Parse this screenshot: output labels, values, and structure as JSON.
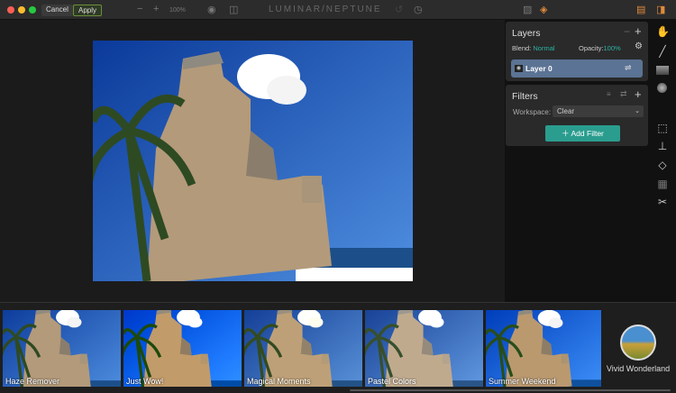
{
  "window": {
    "title": "LUMINAR/NEPTUNE",
    "cancel": "Cancel",
    "apply": "Apply",
    "zoom": "100%",
    "zoom_out": "−",
    "zoom_in": "+"
  },
  "layers": {
    "title": "Layers",
    "blend_label": "Blend:",
    "blend_value": "Normal",
    "opacity_label": "Opacity:",
    "opacity_value": "100%",
    "layer_name": "Layer 0"
  },
  "filters": {
    "title": "Filters",
    "workspace_label": "Workspace:",
    "workspace_value": "Clear",
    "add_filter": "Add Filter"
  },
  "presets": [
    {
      "label": "Haze Remover"
    },
    {
      "label": "Just Wow!"
    },
    {
      "label": "Magical Moments"
    },
    {
      "label": "Pastel Colors"
    },
    {
      "label": "Summer Weekend"
    }
  ],
  "preset_category": {
    "label": "Vivid Wonderland"
  },
  "colors": {
    "accent": "#2a9d8f",
    "layer_bg": "#5b7394"
  }
}
